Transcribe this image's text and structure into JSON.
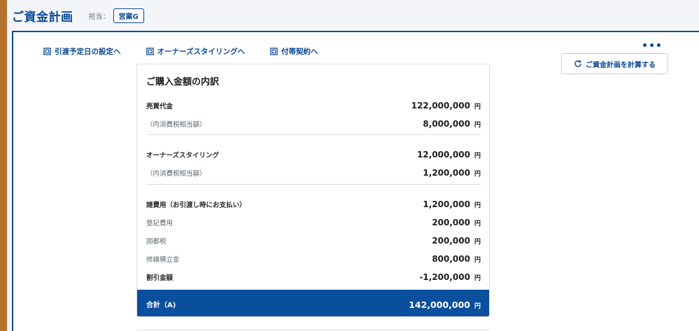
{
  "header": {
    "title": "ご資金計画",
    "owner_label": "担当：",
    "owner_value": "営業G"
  },
  "links": [
    {
      "label": "引渡予定日の設定へ",
      "icon": "open-window-icon"
    },
    {
      "label": "オーナーズスタイリングへ",
      "icon": "open-window-icon"
    },
    {
      "label": "付帯契約へ",
      "icon": "open-window-icon"
    }
  ],
  "more_label": "•••",
  "calc_button": {
    "label": "ご資金計画を計算する",
    "icon": "refresh-icon"
  },
  "breakdown": {
    "title": "ご購入金額の内訳",
    "unit": "円",
    "rows": [
      {
        "label": "売買代金",
        "value": "122,000,000"
      },
      {
        "label": "（内消費税相当額）",
        "value": "8,000,000"
      },
      {
        "label": "オーナーズスタイリング",
        "value": "12,000,000"
      },
      {
        "label": "（内消費税相当額）",
        "value": "1,200,000"
      },
      {
        "label": "諸費用（お引渡し時にお支払い）",
        "value": "1,200,000"
      },
      {
        "label": "登記費用",
        "value": "200,000"
      },
      {
        "label": "固都税",
        "value": "200,000"
      },
      {
        "label": "修繕積立金",
        "value": "800,000"
      },
      {
        "label": "割引金額",
        "value": "-1,200,000"
      }
    ],
    "total": {
      "label": "合計（A)",
      "value": "142,000,000"
    }
  },
  "colors": {
    "brand": "#0c4a97",
    "total_bg": "#0a4e9e",
    "accent_strip": "#b5732f"
  }
}
